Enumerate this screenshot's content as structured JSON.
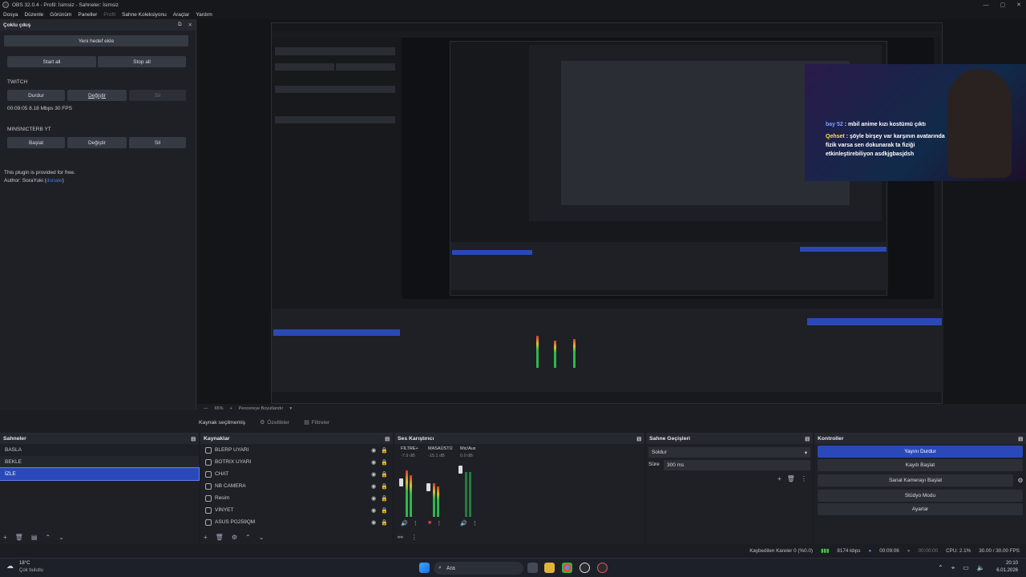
{
  "window": {
    "title": "OBS 32.0.4 - Profil: İsimsiz - Sahneler: İsimsiz"
  },
  "menu": [
    "Dosya",
    "Düzenle",
    "Görünüm",
    "Paneller",
    "Profil",
    "Sahne Koleksiyonu",
    "Araçlar",
    "Yardım"
  ],
  "multiout": {
    "title": "Çoklu çıkış",
    "add_target": "Yeni hedef ekle",
    "start_all": "Start all",
    "stop_all": "Stop all",
    "twitch": {
      "name": "TWITCH",
      "stop": "Durdur",
      "edit": "Değiştir",
      "delete": "Sil",
      "stats": "00:09:05  8.18 Mbps  30 FPS"
    },
    "yt": {
      "name": "MINSNICTERB YT",
      "start": "Başlat",
      "edit": "Değiştir",
      "delete": "Sil"
    },
    "note1": "This plugin is provided for free.",
    "note2": "Author: SoraYuki (",
    "donate": "donate",
    "note3": ")"
  },
  "chat": {
    "line1_user": "bay",
    "line1_user2": "52",
    "line1_text": ": mbil anime kızı kostümü çıktı",
    "line2_user": "Qehset",
    "line2_text": ": şöyle birşey var karşının avatarında fizik varsa sen dokunarak ta fiziği etkinleştirebiliyon asdkjgbasjdsh"
  },
  "zoom": {
    "level": "65%",
    "fit": "Pencereye Boyutlandır"
  },
  "propbar": {
    "no_source": "Kaynak seçilmemiş",
    "properties": "Özellikler",
    "filters": "Filtreler"
  },
  "scenes": {
    "title": "Sahneler",
    "items": [
      "BASLA",
      "BEKLE",
      "İZLE"
    ]
  },
  "sources": {
    "title": "Kaynaklar",
    "items": [
      "BLERP UYARI",
      "BOTRIX UYARI",
      "CHAT",
      "NB CAMERA",
      "Resim",
      "VİNYET",
      "ASUS PG259QM"
    ]
  },
  "mixer": {
    "title": "Ses Karıştırıcı",
    "channels": [
      {
        "name": "FİLTRE+",
        "db": "-7.9 dB"
      },
      {
        "name": "MASAÜSTÜ",
        "db": "-15.1 dB"
      },
      {
        "name": "Mic/Aux",
        "db": "0.0 dB"
      }
    ]
  },
  "transitions": {
    "title": "Sahne Geçişleri",
    "type": "Soldur",
    "duration_label": "Süre",
    "duration": "300 ms"
  },
  "controls": {
    "title": "Kontroller",
    "stop_stream": "Yayını Durdur",
    "start_rec": "Kaydı Başlat",
    "virtual_cam": "Sanal Kamerayı Başlat",
    "studio": "Stüdyo Modu",
    "settings": "Ayarlar"
  },
  "status": {
    "dropped": "Kaybedilen Kareler 0 (%0.0)",
    "bitrate": "8174 kbps",
    "time": "00:09:06",
    "rec_time": "00:00:00",
    "cpu": "CPU: 2.1%",
    "fps": "30.00 / 30.00 FPS"
  },
  "taskbar": {
    "temp": "18°C",
    "weather": "Çok bulutlu",
    "search": "Ara",
    "clock": "20:10",
    "date": "6.01.2026"
  },
  "colors": {
    "accent": "#2a49b8",
    "bg": "#1e2026"
  }
}
